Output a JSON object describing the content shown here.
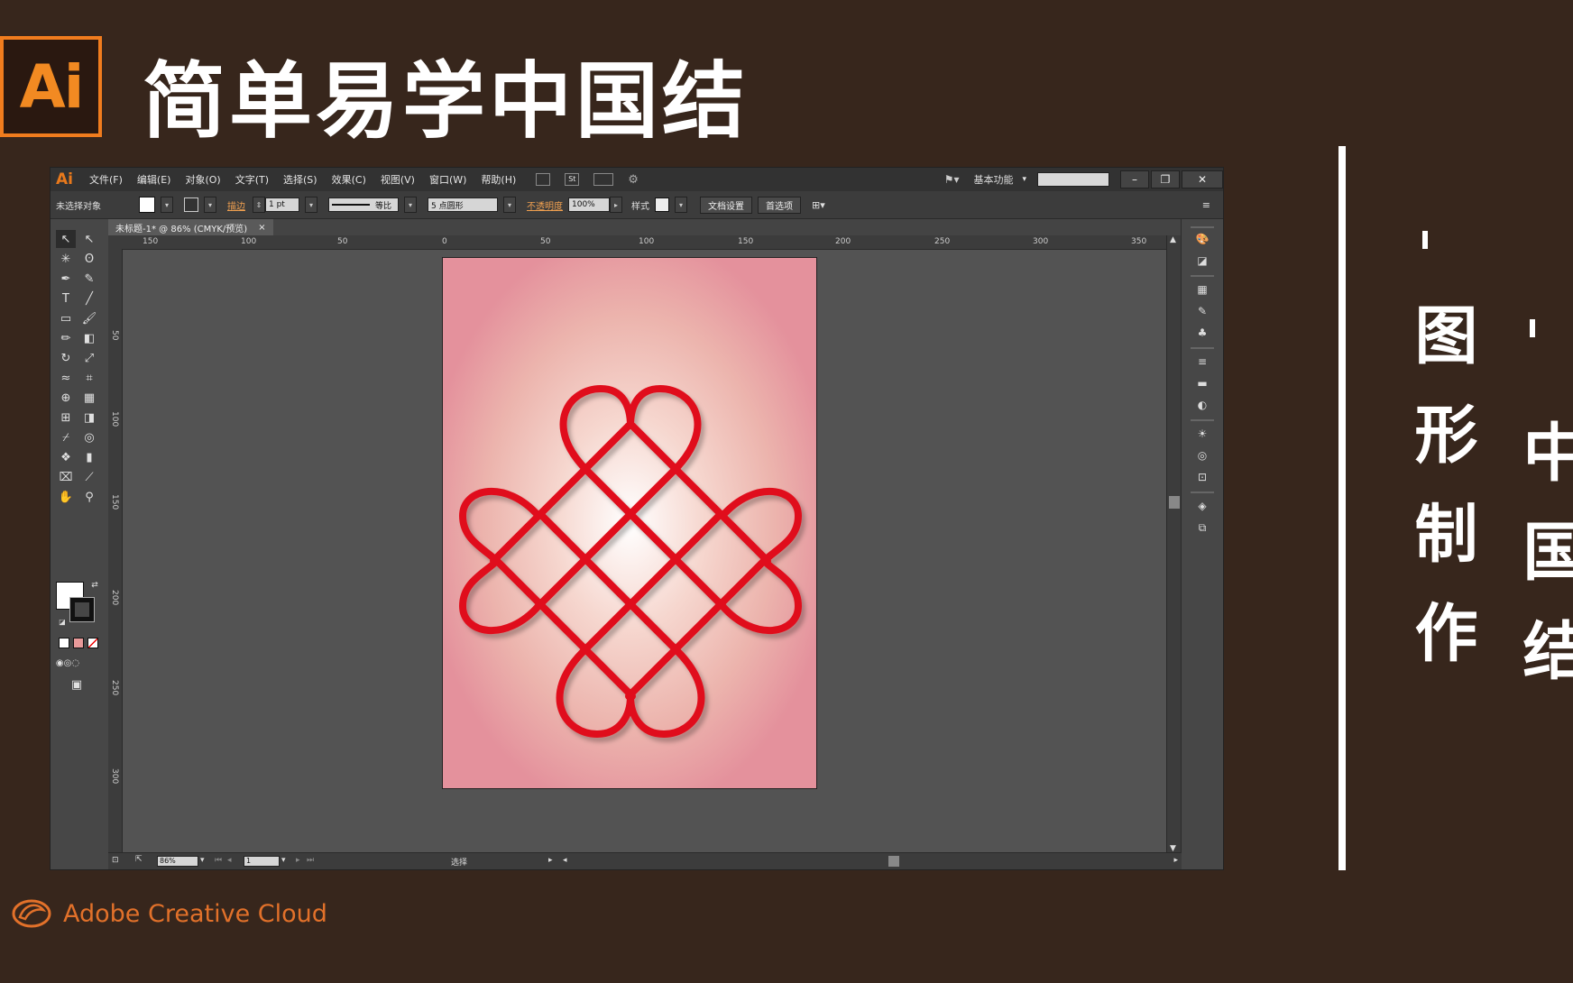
{
  "banner": {
    "logo_text": "Ai",
    "title": "简单易学中国结",
    "vertical_left": "图形制作",
    "vertical_right": "中国结",
    "brand": "Adobe Creative Cloud"
  },
  "app": {
    "logo": "Ai",
    "menu": [
      "文件(F)",
      "编辑(E)",
      "对象(O)",
      "文字(T)",
      "选择(S)",
      "效果(C)",
      "视图(V)",
      "窗口(W)",
      "帮助(H)"
    ],
    "menu_extra": "St",
    "workspace": "基本功能",
    "window_buttons": [
      "–",
      "❐",
      "✕"
    ],
    "control": {
      "no_selection": "未选择对象",
      "stroke_label": "描边",
      "stroke_value": "1 pt",
      "profile": "等比",
      "brush": "5 点圆形",
      "opacity_label": "不透明度",
      "opacity_value": "100%",
      "style_label": "样式",
      "doc_setup": "文档设置",
      "preferences": "首选项"
    },
    "doc_tab": "未标题-1* @ 86% (CMYK/预览)",
    "doc_tab_close": "×",
    "ruler_h": [
      "150",
      "100",
      "50",
      "0",
      "50",
      "100",
      "150",
      "200",
      "250",
      "300",
      "350"
    ],
    "ruler_v": [
      "50",
      "100",
      "150",
      "200",
      "250",
      "300"
    ],
    "status": {
      "zoom": "86%",
      "page": "1",
      "tool": "选择"
    },
    "colors": {
      "knot": "#e0101c",
      "accent": "#f07c1e"
    }
  }
}
